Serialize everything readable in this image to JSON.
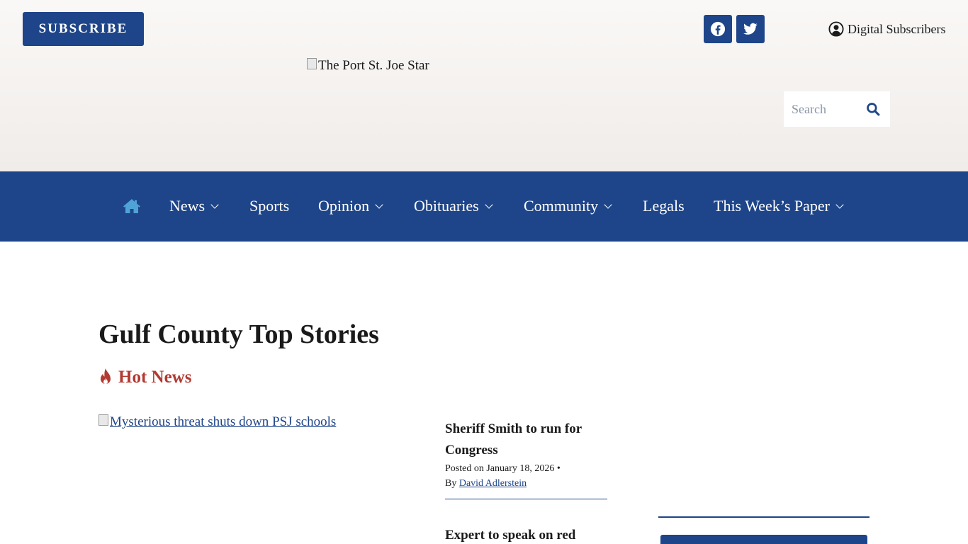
{
  "header": {
    "subscribe_label": "SUBSCRIBE",
    "social": [
      {
        "name": "facebook-icon"
      },
      {
        "name": "twitter-icon"
      }
    ],
    "digital_subscribers_label": "Digital Subscribers",
    "logo_alt": "The Port St. Joe Star",
    "search": {
      "placeholder": "Search"
    }
  },
  "nav": {
    "items": [
      {
        "label": "News",
        "dropdown": true
      },
      {
        "label": "Sports",
        "dropdown": false
      },
      {
        "label": "Opinion",
        "dropdown": true
      },
      {
        "label": "Obituaries",
        "dropdown": true
      },
      {
        "label": "Community",
        "dropdown": true
      },
      {
        "label": "Legals",
        "dropdown": false
      },
      {
        "label": "This Week’s Paper",
        "dropdown": true
      }
    ]
  },
  "main": {
    "page_title": "Gulf County Top Stories",
    "section_label": "Hot News",
    "feature_alt": "Mysterious threat shuts down PSJ schools",
    "stories": [
      {
        "title": "Sheriff Smith to run for Congress",
        "posted": "Posted on January 18, 2026",
        "separator": "•",
        "by": "By",
        "author": "David Adlerstein"
      },
      {
        "title": "Expert to speak on red"
      }
    ]
  },
  "colors": {
    "brand_blue": "#1e4589",
    "hot_red": "#b23a32",
    "home_icon": "#4fa3d6"
  }
}
